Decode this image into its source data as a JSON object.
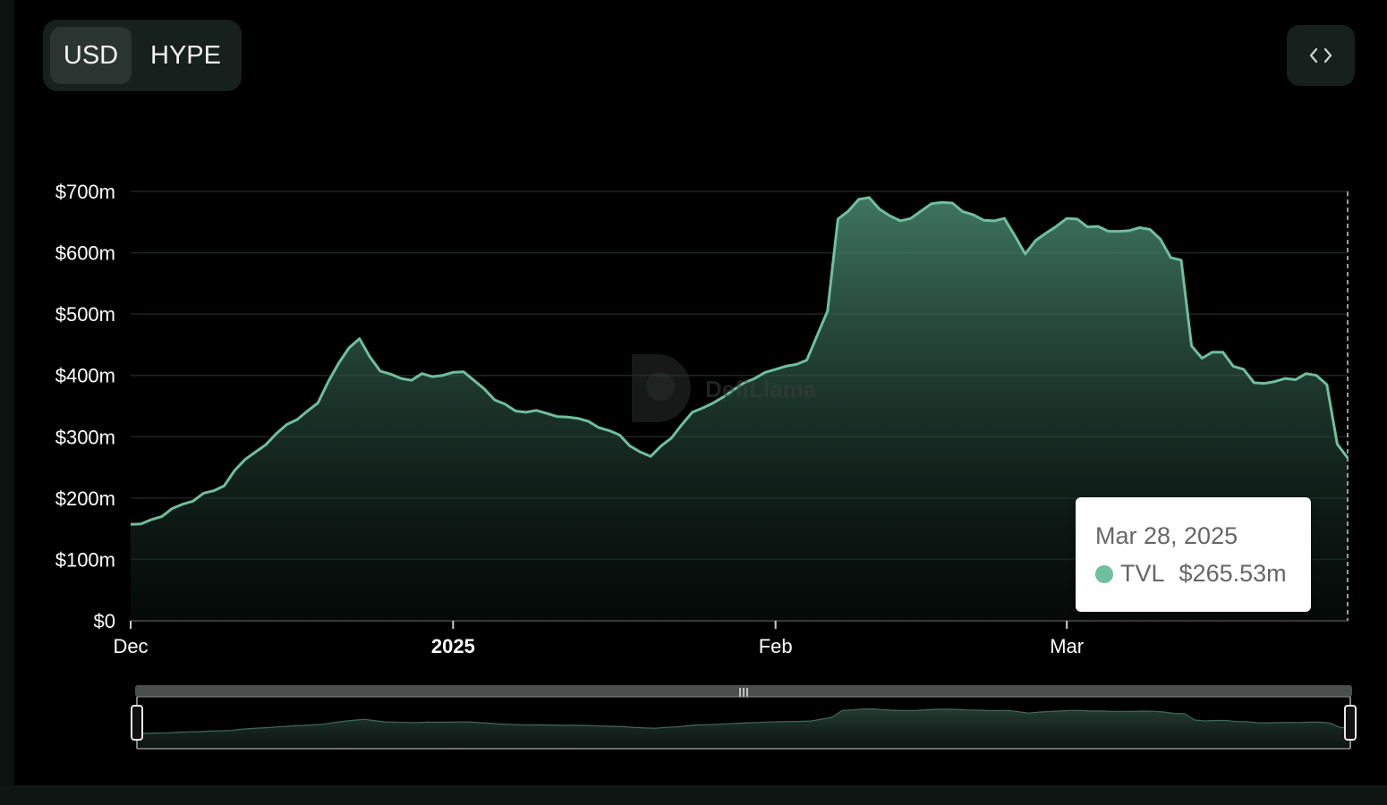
{
  "currency_toggle": {
    "options": [
      "USD",
      "HYPE"
    ],
    "selected": "USD"
  },
  "embed_button": {
    "icon": "code-brackets-icon"
  },
  "watermark": {
    "text": "DefiLlama"
  },
  "colors": {
    "line": "#6fbf9e",
    "area_top": "#4a8a71",
    "grid": "#1e2422",
    "axis": "#9aa39f"
  },
  "tooltip": {
    "date": "Mar 28, 2025",
    "series": "TVL",
    "value": "$265.53m"
  },
  "chart_data": {
    "type": "area",
    "title": "",
    "xlabel": "",
    "ylabel": "",
    "ylim": [
      0,
      700000000
    ],
    "grid": true,
    "y_ticks": [
      {
        "value": 0,
        "label": "$0"
      },
      {
        "value": 100000000,
        "label": "$100m"
      },
      {
        "value": 200000000,
        "label": "$200m"
      },
      {
        "value": 300000000,
        "label": "$300m"
      },
      {
        "value": 400000000,
        "label": "$400m"
      },
      {
        "value": 500000000,
        "label": "$500m"
      },
      {
        "value": 600000000,
        "label": "$600m"
      },
      {
        "value": 700000000,
        "label": "$700m"
      }
    ],
    "x_ticks": [
      {
        "date": "2024-12-01",
        "label": "Dec",
        "bold": false
      },
      {
        "date": "2025-01-01",
        "label": "2025",
        "bold": true
      },
      {
        "date": "2025-02-01",
        "label": "Feb",
        "bold": false
      },
      {
        "date": "2025-03-01",
        "label": "Mar",
        "bold": false
      }
    ],
    "xlim": [
      "2024-12-01",
      "2025-03-28"
    ],
    "series": [
      {
        "name": "TVL",
        "points": [
          [
            "2024-12-01",
            157
          ],
          [
            "2024-12-02",
            158
          ],
          [
            "2024-12-03",
            165
          ],
          [
            "2024-12-04",
            170
          ],
          [
            "2024-12-05",
            183
          ],
          [
            "2024-12-06",
            190
          ],
          [
            "2024-12-07",
            195
          ],
          [
            "2024-12-08",
            208
          ],
          [
            "2024-12-09",
            212
          ],
          [
            "2024-12-10",
            220
          ],
          [
            "2024-12-11",
            245
          ],
          [
            "2024-12-12",
            263
          ],
          [
            "2024-12-13",
            275
          ],
          [
            "2024-12-14",
            287
          ],
          [
            "2024-12-15",
            305
          ],
          [
            "2024-12-16",
            320
          ],
          [
            "2024-12-17",
            328
          ],
          [
            "2024-12-18",
            342
          ],
          [
            "2024-12-19",
            355
          ],
          [
            "2024-12-20",
            390
          ],
          [
            "2024-12-21",
            420
          ],
          [
            "2024-12-22",
            445
          ],
          [
            "2024-12-23",
            460
          ],
          [
            "2024-12-24",
            430
          ],
          [
            "2024-12-25",
            407
          ],
          [
            "2024-12-26",
            402
          ],
          [
            "2024-12-27",
            395
          ],
          [
            "2024-12-28",
            392
          ],
          [
            "2024-12-29",
            403
          ],
          [
            "2024-12-30",
            398
          ],
          [
            "2024-12-31",
            400
          ],
          [
            "2025-01-01",
            405
          ],
          [
            "2025-01-02",
            406
          ],
          [
            "2025-01-03",
            392
          ],
          [
            "2025-01-04",
            378
          ],
          [
            "2025-01-05",
            360
          ],
          [
            "2025-01-06",
            353
          ],
          [
            "2025-01-07",
            342
          ],
          [
            "2025-01-08",
            340
          ],
          [
            "2025-01-09",
            343
          ],
          [
            "2025-01-10",
            338
          ],
          [
            "2025-01-11",
            333
          ],
          [
            "2025-01-12",
            332
          ],
          [
            "2025-01-13",
            330
          ],
          [
            "2025-01-14",
            325
          ],
          [
            "2025-01-15",
            315
          ],
          [
            "2025-01-16",
            310
          ],
          [
            "2025-01-17",
            303
          ],
          [
            "2025-01-18",
            285
          ],
          [
            "2025-01-19",
            275
          ],
          [
            "2025-01-20",
            268
          ],
          [
            "2025-01-21",
            285
          ],
          [
            "2025-01-22",
            298
          ],
          [
            "2025-01-23",
            320
          ],
          [
            "2025-01-24",
            340
          ],
          [
            "2025-01-25",
            347
          ],
          [
            "2025-01-26",
            355
          ],
          [
            "2025-01-27",
            365
          ],
          [
            "2025-01-28",
            377
          ],
          [
            "2025-01-29",
            388
          ],
          [
            "2025-01-30",
            395
          ],
          [
            "2025-01-31",
            405
          ],
          [
            "2025-02-01",
            410
          ],
          [
            "2025-02-02",
            415
          ],
          [
            "2025-02-03",
            418
          ],
          [
            "2025-02-04",
            425
          ],
          [
            "2025-02-05",
            465
          ],
          [
            "2025-02-06",
            505
          ],
          [
            "2025-02-07",
            655
          ],
          [
            "2025-02-08",
            668
          ],
          [
            "2025-02-09",
            687
          ],
          [
            "2025-02-10",
            690
          ],
          [
            "2025-02-11",
            671
          ],
          [
            "2025-02-12",
            660
          ],
          [
            "2025-02-13",
            652
          ],
          [
            "2025-02-14",
            656
          ],
          [
            "2025-02-15",
            668
          ],
          [
            "2025-02-16",
            680
          ],
          [
            "2025-02-17",
            682
          ],
          [
            "2025-02-18",
            681
          ],
          [
            "2025-02-19",
            667
          ],
          [
            "2025-02-20",
            662
          ],
          [
            "2025-02-21",
            653
          ],
          [
            "2025-02-22",
            652
          ],
          [
            "2025-02-23",
            656
          ],
          [
            "2025-02-24",
            628
          ],
          [
            "2025-02-25",
            598
          ],
          [
            "2025-02-26",
            620
          ],
          [
            "2025-02-27",
            632
          ],
          [
            "2025-02-28",
            643
          ],
          [
            "2025-03-01",
            656
          ],
          [
            "2025-03-02",
            655
          ],
          [
            "2025-03-03",
            642
          ],
          [
            "2025-03-04",
            643
          ],
          [
            "2025-03-05",
            635
          ],
          [
            "2025-03-06",
            635
          ],
          [
            "2025-03-07",
            636
          ],
          [
            "2025-03-08",
            641
          ],
          [
            "2025-03-09",
            638
          ],
          [
            "2025-03-10",
            622
          ],
          [
            "2025-03-11",
            592
          ],
          [
            "2025-03-12",
            588
          ],
          [
            "2025-03-13",
            448
          ],
          [
            "2025-03-14",
            428
          ],
          [
            "2025-03-15",
            438
          ],
          [
            "2025-03-16",
            438
          ],
          [
            "2025-03-17",
            415
          ],
          [
            "2025-03-18",
            410
          ],
          [
            "2025-03-19",
            388
          ],
          [
            "2025-03-20",
            387
          ],
          [
            "2025-03-21",
            390
          ],
          [
            "2025-03-22",
            395
          ],
          [
            "2025-03-23",
            393
          ],
          [
            "2025-03-24",
            403
          ],
          [
            "2025-03-25",
            400
          ],
          [
            "2025-03-26",
            385
          ],
          [
            "2025-03-27",
            288
          ],
          [
            "2025-03-28",
            265.53
          ]
        ],
        "unit": "$m"
      }
    ]
  }
}
